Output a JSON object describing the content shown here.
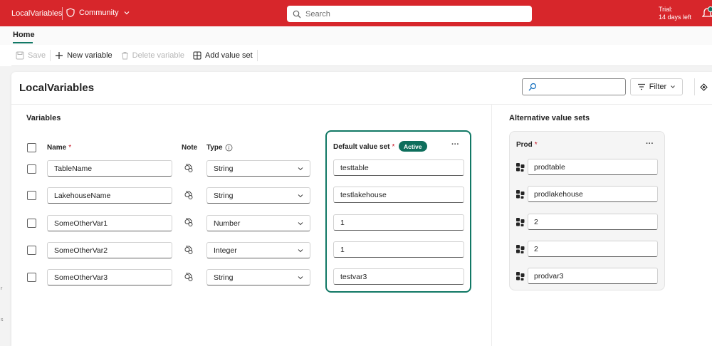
{
  "topbar": {
    "app_title": "LocalVariables",
    "workspace_label": "Community",
    "search_placeholder": "Search",
    "trial_line1": "Trial:",
    "trial_line2": "14 days left",
    "bg_color": "#d7262b"
  },
  "tabs": {
    "home": "Home"
  },
  "toolbar": {
    "save": "Save",
    "new_variable": "New variable",
    "delete_variable": "Delete variable",
    "add_value_set": "Add value set"
  },
  "page": {
    "title": "LocalVariables",
    "filter_label": "Filter"
  },
  "variables": {
    "section_title": "Variables",
    "columns": {
      "name": "Name",
      "note": "Note",
      "type": "Type",
      "required_mark": "*"
    },
    "rows": [
      {
        "name": "TableName",
        "type": "String",
        "default": "testtable",
        "alt": "prodtable"
      },
      {
        "name": "LakehouseName",
        "type": "String",
        "default": "testlakehouse",
        "alt": "prodlakehouse"
      },
      {
        "name": "SomeOtherVar1",
        "type": "Number",
        "default": "1",
        "alt": "2"
      },
      {
        "name": "SomeOtherVar2",
        "type": "Integer",
        "default": "1",
        "alt": "2"
      },
      {
        "name": "SomeOtherVar3",
        "type": "String",
        "default": "testvar3",
        "alt": "prodvar3"
      }
    ]
  },
  "default_set": {
    "title": "Default value set",
    "badge": "Active",
    "more": "···",
    "accent_color": "#117865"
  },
  "alternatives": {
    "section_title": "Alternative value sets",
    "set_name": "Prod",
    "more": "···"
  }
}
